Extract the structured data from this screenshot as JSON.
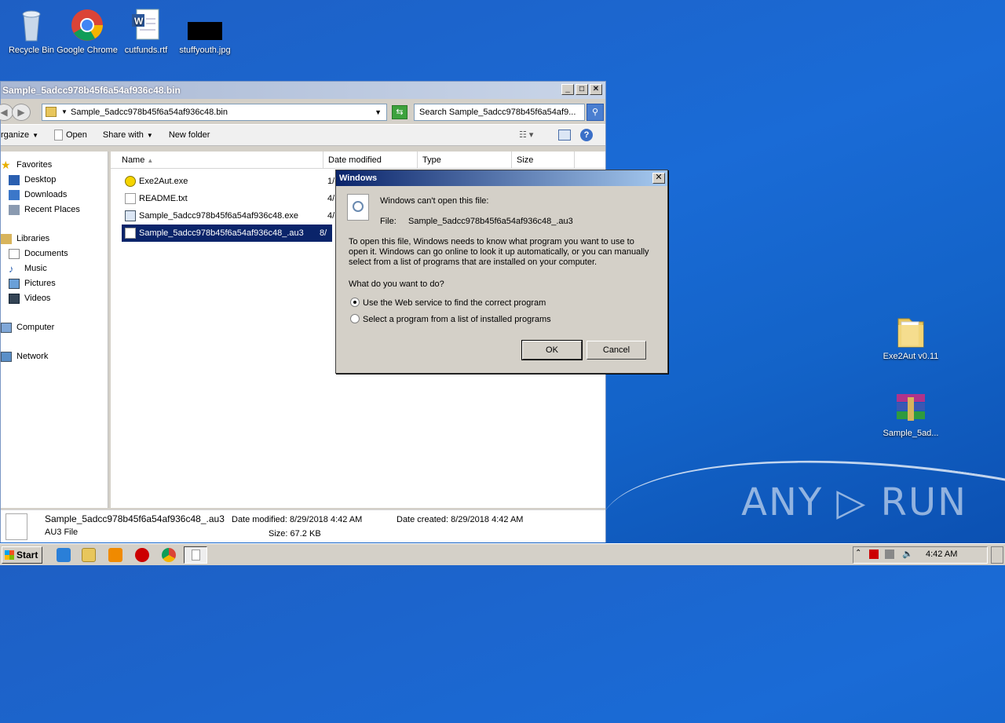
{
  "desktop": {
    "icons": [
      {
        "label": "Recycle Bin",
        "icon": "recycle-bin-icon"
      },
      {
        "label": "Google Chrome",
        "icon": "chrome-icon"
      },
      {
        "label": "cutfunds.rtf",
        "icon": "word-document-icon"
      },
      {
        "label": "stuffyouth.jpg",
        "icon": "image-file-icon"
      },
      {
        "label": "Exe2Aut v0.11",
        "icon": "folder-icon"
      },
      {
        "label": "Sample_5ad...",
        "icon": "winrar-archive-icon"
      }
    ],
    "watermark": "ANY ▷ RUN"
  },
  "explorer": {
    "title": "Sample_5adcc978b45f6a54af936c48.bin",
    "address": "Sample_5adcc978b45f6a54af936c48.bin",
    "search_placeholder": "Search Sample_5adcc978b45f6a54af9...",
    "toolbar": {
      "organize": "rganize",
      "open": "Open",
      "share_with": "Share with",
      "new_folder": "New folder"
    },
    "nav": {
      "favorites": "Favorites",
      "desktop": "Desktop",
      "downloads": "Downloads",
      "recent_places": "Recent Places",
      "libraries": "Libraries",
      "documents": "Documents",
      "music": "Music",
      "pictures": "Pictures",
      "videos": "Videos",
      "computer": "Computer",
      "network": "Network"
    },
    "columns": {
      "name": "Name",
      "date_modified": "Date modified",
      "type": "Type",
      "size": "Size"
    },
    "files": [
      {
        "name": "Exe2Aut.exe",
        "date": "1/"
      },
      {
        "name": "README.txt",
        "date": "4/"
      },
      {
        "name": "Sample_5adcc978b45f6a54af936c48.exe",
        "date": "4/"
      },
      {
        "name": "Sample_5adcc978b45f6a54af936c48_.au3",
        "date": "8/"
      }
    ],
    "details": {
      "filename": "Sample_5adcc978b45f6a54af936c48_.au3",
      "type": "AU3 File",
      "date_modified": "Date modified: 8/29/2018 4:42 AM",
      "date_created": "Date created: 8/29/2018 4:42 AM",
      "size": "Size: 67.2 KB"
    }
  },
  "dialog": {
    "title": "Windows",
    "heading": "Windows can't open this file:",
    "file_label": "File:",
    "file_name": "Sample_5adcc978b45f6a54af936c48_.au3",
    "explanation_1": "To open this file, Windows needs to know what program you want to use to",
    "explanation_2": "open it. Windows can go online to look it up automatically, or you can manually",
    "explanation_3": "select from a list of programs that are installed on your computer.",
    "question": "What do you want to do?",
    "option_web": "Use the Web service to find the correct program",
    "option_list": "Select a program from a list of installed programs",
    "ok": "OK",
    "cancel": "Cancel"
  },
  "taskbar": {
    "start": "Start",
    "clock": "4:42 AM"
  }
}
